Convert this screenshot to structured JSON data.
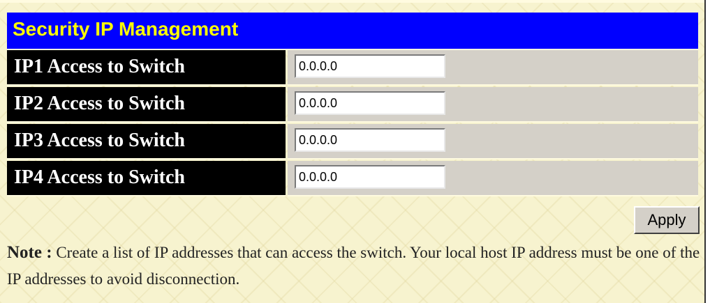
{
  "header": {
    "title": "Security IP Management"
  },
  "rows": [
    {
      "label": "IP1 Access to Switch",
      "value": "0.0.0.0"
    },
    {
      "label": "IP2 Access to Switch",
      "value": "0.0.0.0"
    },
    {
      "label": "IP3 Access to Switch",
      "value": "0.0.0.0"
    },
    {
      "label": "IP4 Access to Switch",
      "value": "0.0.0.0"
    }
  ],
  "apply_label": "Apply",
  "note": {
    "label": "Note :",
    "text": "Create a list of IP addresses that can access the switch. Your local host IP address must be one of the IP addresses to avoid disconnection."
  },
  "colors": {
    "header_bg": "#0000ff",
    "header_text": "#ffff00",
    "label_bg": "#000000",
    "field_bg": "#d4d0c8"
  }
}
